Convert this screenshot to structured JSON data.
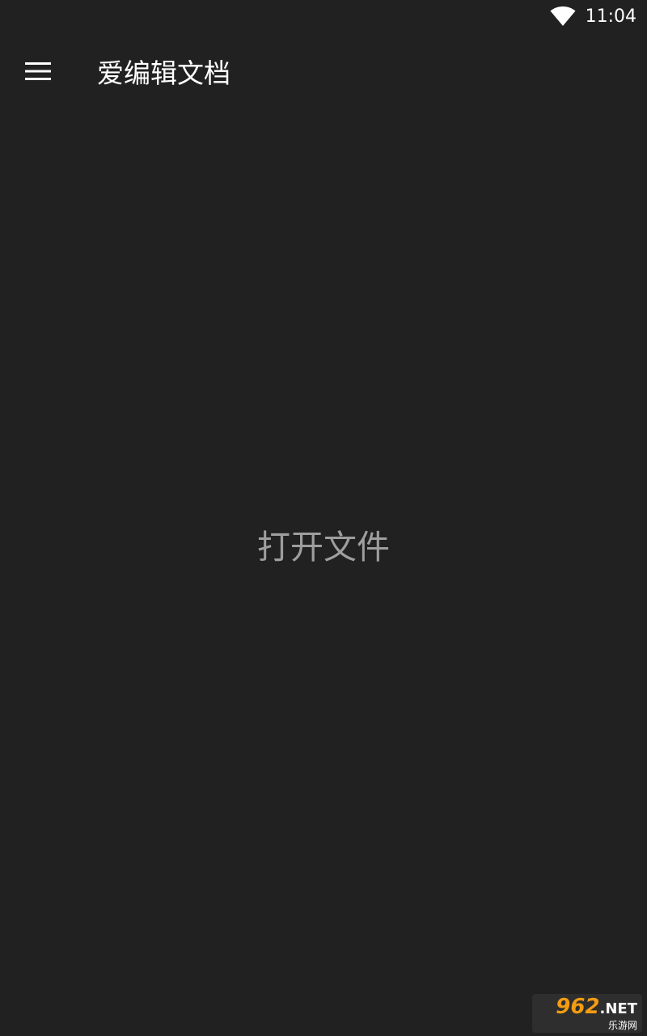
{
  "status_bar": {
    "time": "11:04",
    "wifi_icon": "wifi-icon"
  },
  "app_bar": {
    "menu_icon": "hamburger-menu-icon",
    "title": "爱编辑文档"
  },
  "main": {
    "open_file_label": "打开文件"
  },
  "watermark": {
    "brand_number": "962",
    "brand_suffix": ".NET",
    "brand_subtitle": "乐游网"
  },
  "colors": {
    "background": "#212121",
    "title_text": "#ffffff",
    "placeholder_text": "#9e9e9e"
  }
}
